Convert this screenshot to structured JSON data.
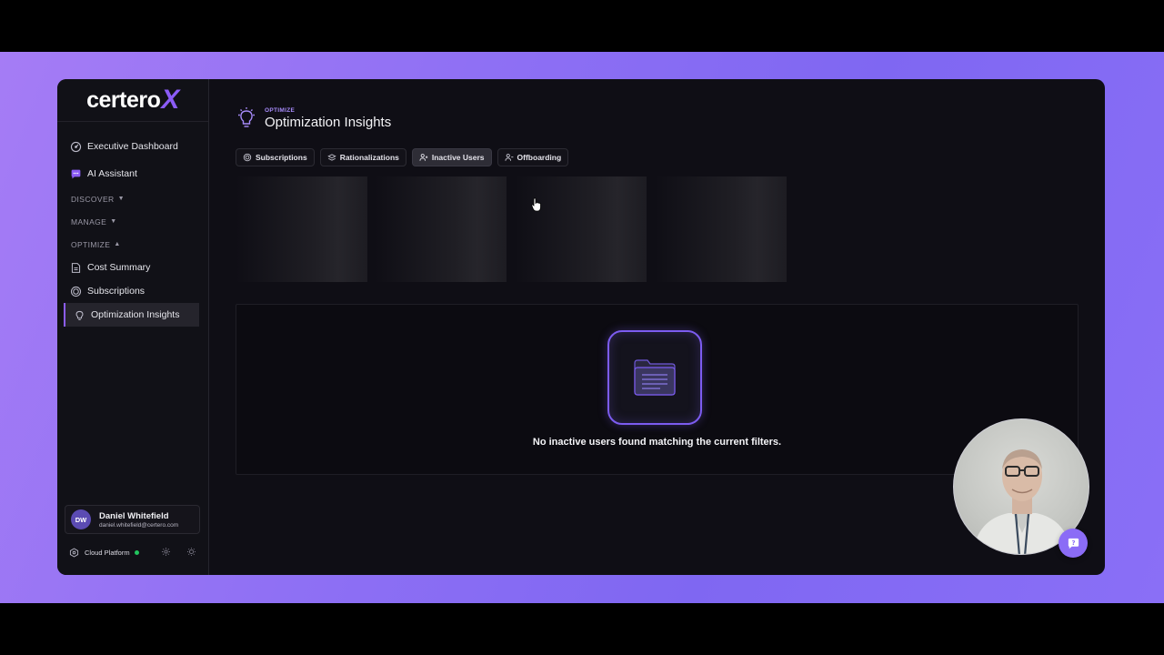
{
  "brand": {
    "name_main": "certero",
    "name_x": "X"
  },
  "sidebar": {
    "items_top": [
      {
        "label": "Executive Dashboard",
        "icon": "gauge-icon"
      },
      {
        "label": "AI Assistant",
        "icon": "chat-icon"
      }
    ],
    "sections": [
      {
        "label": "DISCOVER",
        "expanded": false
      },
      {
        "label": "MANAGE",
        "expanded": false
      },
      {
        "label": "OPTIMIZE",
        "expanded": true
      }
    ],
    "optimize_items": [
      {
        "label": "Cost Summary",
        "icon": "document-icon"
      },
      {
        "label": "Subscriptions",
        "icon": "coin-icon"
      },
      {
        "label": "Optimization Insights",
        "icon": "lightbulb-icon",
        "active": true
      }
    ],
    "user": {
      "initials": "DW",
      "name": "Daniel Whitefield",
      "email": "daniel.whitefield@certero.com"
    },
    "footer": {
      "platform": "Cloud Platform",
      "status_color": "#22c55e"
    }
  },
  "header": {
    "eyebrow": "OPTIMIZE",
    "title": "Optimization Insights"
  },
  "tabs": [
    {
      "label": "Subscriptions",
      "icon": "coin-icon"
    },
    {
      "label": "Rationalizations",
      "icon": "layers-icon"
    },
    {
      "label": "Inactive Users",
      "icon": "user-x-icon",
      "active": true
    },
    {
      "label": "Offboarding",
      "icon": "user-minus-icon"
    }
  ],
  "empty_state": {
    "message": "No inactive users found matching the current filters.",
    "icon": "folder-list-icon"
  },
  "colors": {
    "accent": "#8b5cf6",
    "background": "#0f0e15",
    "backdrop": "#8f70f4"
  }
}
